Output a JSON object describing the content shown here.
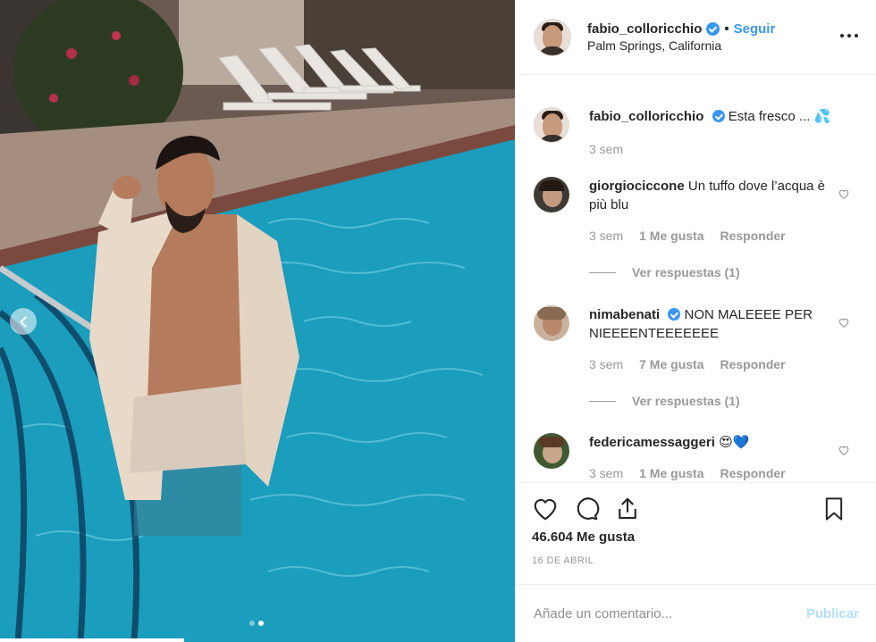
{
  "post": {
    "photo_alt": "",
    "carousel_total": 2,
    "carousel_active": 2
  },
  "header": {
    "username": "fabio_colloricchio",
    "follow_label": "Seguir",
    "bullet": "•",
    "location": "Palm Springs, California",
    "more_icon": "ellipsis-icon"
  },
  "caption": {
    "username": "fabio_colloricchio",
    "text": "Esta fresco ... 💦",
    "time": "3 sem"
  },
  "comments": [
    {
      "username": "giorgiociccone",
      "text": "Un tuffo dove l’acqua è più blu",
      "time": "3 sem",
      "likes": "1 Me gusta",
      "reply_label": "Responder",
      "view_replies": "Ver respuestas (1)"
    },
    {
      "username": "nimabenati",
      "verified": true,
      "text": "NON MALEEEE PER NIEEEENTEEEEEEE",
      "time": "3 sem",
      "likes": "7 Me gusta",
      "reply_label": "Responder",
      "view_replies": "Ver respuestas (1)"
    },
    {
      "username": "federicamessaggeri",
      "text": "😍💙",
      "time": "3 sem",
      "likes": "1 Me gusta",
      "reply_label": "Responder"
    }
  ],
  "actions": {
    "like_count": "46.604 Me gusta",
    "date": "16 DE ABRIL"
  },
  "add_comment": {
    "placeholder": "Añade un comentario...",
    "publish_label": "Publicar"
  },
  "colors": {
    "accent": "#3897f0",
    "publish_disabled": "#b2dffc",
    "muted": "#999999"
  }
}
